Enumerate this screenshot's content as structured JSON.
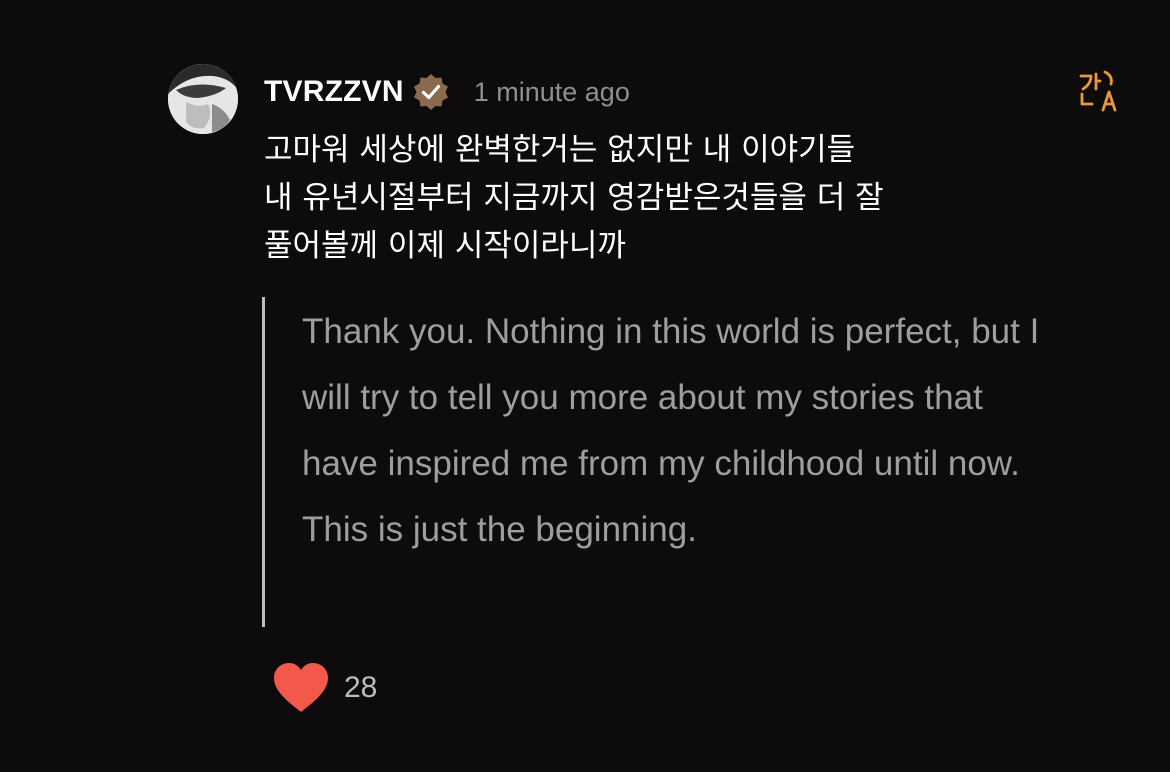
{
  "comment": {
    "username": "TVRZZVN",
    "timestamp": "1 minute ago",
    "original_text": "고마워 세상에 완벽한거는 없지만 내 이야기들\n내 유년시절부터 지금까지 영감받은것들을 더 잘\n풀어볼께 이제 시작이라니까",
    "translation": "Thank you. Nothing in this world is perfect, but I will try to tell you more about my stories that have inspired me from my childhood until now. This is just the beginning.",
    "like_count": "28"
  },
  "icons": {
    "avatar": "avatar",
    "verified": "verified-badge-icon",
    "translate": "translate-icon",
    "like": "heart-icon"
  },
  "colors": {
    "background": "#0d0b0b",
    "verified_badge": "#8a6a4f",
    "translate_accent": "#e9983f",
    "heart": "#f2584c",
    "secondary_text": "#9e9e9e"
  }
}
